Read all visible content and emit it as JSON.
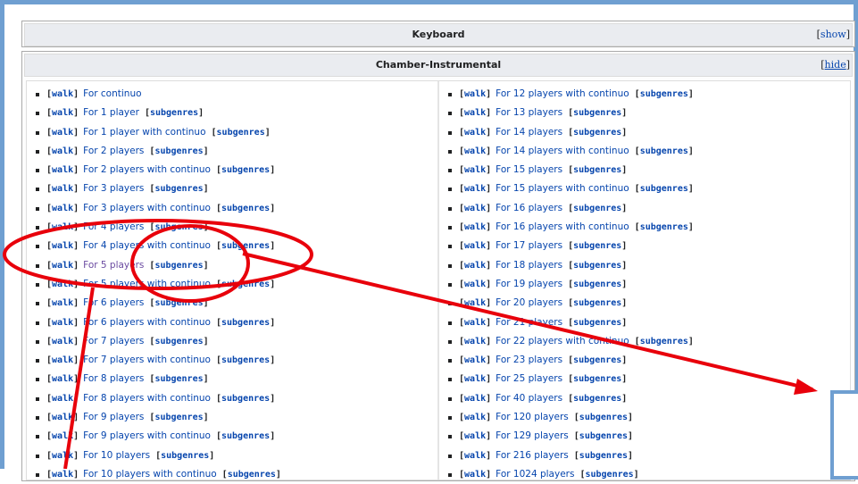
{
  "keyboard_box": {
    "title": "Keyboard",
    "toggle_open": "[",
    "toggle_label": "show",
    "toggle_close": "]"
  },
  "chamber_box": {
    "title": "Chamber-Instrumental",
    "toggle_open": "[",
    "toggle_label": "hide",
    "toggle_close": "]"
  },
  "walk_label": "walk",
  "subgenres_label": "subgenres",
  "left_items": [
    {
      "label": "For continuo",
      "sub": false
    },
    {
      "label": "For 1 player",
      "sub": true
    },
    {
      "label": "For 1 player with continuo",
      "sub": true
    },
    {
      "label": "For 2 players",
      "sub": true
    },
    {
      "label": "For 2 players with continuo",
      "sub": true
    },
    {
      "label": "For 3 players",
      "sub": true
    },
    {
      "label": "For 3 players with continuo",
      "sub": true
    },
    {
      "label": "For 4 players",
      "sub": true
    },
    {
      "label": "For 4 players with continuo",
      "sub": true
    },
    {
      "label": "For 5 players",
      "sub": true,
      "visited": true
    },
    {
      "label": "For 5 players with continuo",
      "sub": true
    },
    {
      "label": "For 6 players",
      "sub": true
    },
    {
      "label": "For 6 players with continuo",
      "sub": true
    },
    {
      "label": "For 7 players",
      "sub": true
    },
    {
      "label": "For 7 players with continuo",
      "sub": true
    },
    {
      "label": "For 8 players",
      "sub": true
    },
    {
      "label": "For 8 players with continuo",
      "sub": true
    },
    {
      "label": "For 9 players",
      "sub": true
    },
    {
      "label": "For 9 players with continuo",
      "sub": true
    },
    {
      "label": "For 10 players",
      "sub": true
    },
    {
      "label": "For 10 players with continuo",
      "sub": true
    }
  ],
  "right_items": [
    {
      "label": "For 12 players with continuo",
      "sub": true
    },
    {
      "label": "For 13 players",
      "sub": true
    },
    {
      "label": "For 14 players",
      "sub": true
    },
    {
      "label": "For 14 players with continuo",
      "sub": true
    },
    {
      "label": "For 15 players",
      "sub": true
    },
    {
      "label": "For 15 players with continuo",
      "sub": true
    },
    {
      "label": "For 16 players",
      "sub": true
    },
    {
      "label": "For 16 players with continuo",
      "sub": true
    },
    {
      "label": "For 17 players",
      "sub": true
    },
    {
      "label": "For 18 players",
      "sub": true
    },
    {
      "label": "For 19 players",
      "sub": true
    },
    {
      "label": "For 20 players",
      "sub": true
    },
    {
      "label": "For 21 players",
      "sub": true
    },
    {
      "label": "For 22 players with continuo",
      "sub": true
    },
    {
      "label": "For 23 players",
      "sub": true
    },
    {
      "label": "For 25 players",
      "sub": true
    },
    {
      "label": "For 40 players",
      "sub": true
    },
    {
      "label": "For 120 players",
      "sub": true
    },
    {
      "label": "For 129 players",
      "sub": true
    },
    {
      "label": "For 216 players",
      "sub": true
    },
    {
      "label": "For 1024 players",
      "sub": true
    }
  ],
  "colors": {
    "annotation": "#e8000b",
    "frame": "#6f9fd1",
    "link": "#0645ad",
    "visited": "#6b4ba1"
  }
}
